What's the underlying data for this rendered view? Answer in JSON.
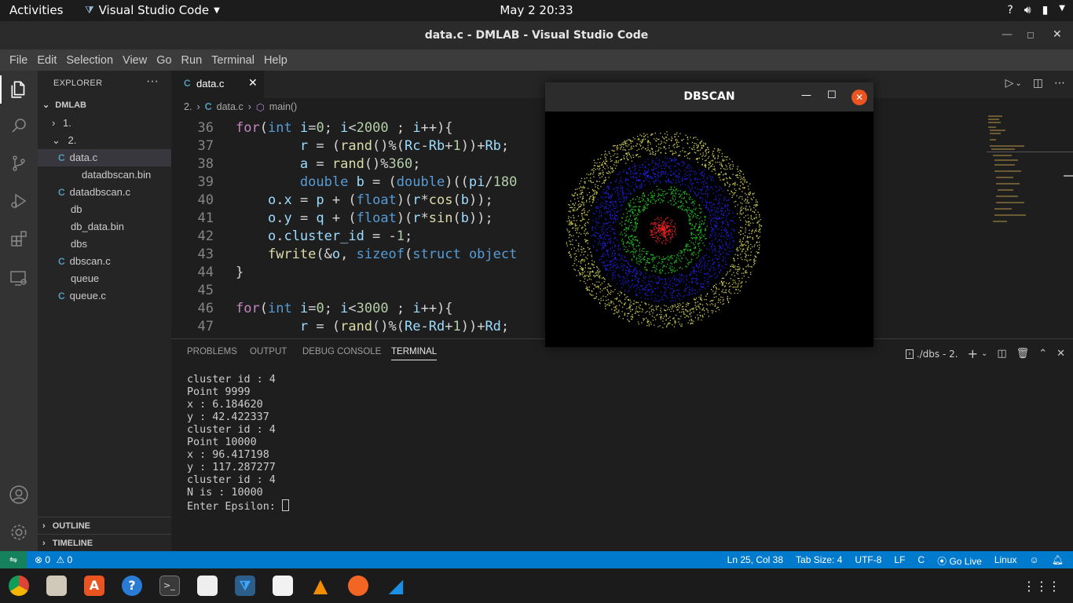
{
  "topbar": {
    "activities": "Activities",
    "app_name": "Visual Studio Code",
    "clock": "May 2  20:33"
  },
  "window": {
    "title": "data.c - DMLAB - Visual Studio Code"
  },
  "menu": [
    "File",
    "Edit",
    "Selection",
    "View",
    "Go",
    "Run",
    "Terminal",
    "Help"
  ],
  "sidebar": {
    "header": "EXPLORER",
    "root": "DMLAB",
    "folders": [
      "1.",
      "2."
    ],
    "files": [
      {
        "name": "data.c",
        "c": true
      },
      {
        "name": "datadbscan.bin",
        "c": false
      },
      {
        "name": "datadbscan.c",
        "c": true
      },
      {
        "name": "db",
        "c": false
      },
      {
        "name": "db_data.bin",
        "c": false
      },
      {
        "name": "dbs",
        "c": false
      },
      {
        "name": "dbscan.c",
        "c": true
      },
      {
        "name": "queue",
        "c": false
      },
      {
        "name": "queue.c",
        "c": true
      }
    ],
    "outline": "OUTLINE",
    "timeline": "TIMELINE"
  },
  "editor": {
    "tab": "data.c",
    "breadcrumb": [
      "2.",
      "data.c",
      "main()"
    ],
    "lines": [
      36,
      37,
      38,
      39,
      40,
      41,
      42,
      43,
      44,
      45,
      46,
      47
    ]
  },
  "panel": {
    "tabs": [
      "PROBLEMS",
      "OUTPUT",
      "DEBUG CONSOLE",
      "TERMINAL"
    ],
    "terminal_name": "./dbs - 2.",
    "terminal_lines": [
      "cluster id : 4",
      "",
      "Point 9999",
      "x : 6.184620",
      "y : 42.422337",
      "cluster id : 4",
      "",
      "Point 10000",
      "x : 96.417198",
      "y : 117.287277",
      "cluster id : 4",
      "",
      "N is : 10000",
      "Enter Epsilon: "
    ]
  },
  "status": {
    "problems": "0",
    "warnings": "0",
    "position": "Ln 25, Col 38",
    "tab_size": "Tab Size: 4",
    "encoding": "UTF-8",
    "eol": "LF",
    "language": "C",
    "go_live": "Go Live",
    "os": "Linux"
  },
  "dbscan": {
    "title": "DBSCAN",
    "rings": [
      {
        "color": "#c8c850"
      },
      {
        "color": "#2020d8"
      },
      {
        "color": "#20c020"
      },
      {
        "color": "#e02020"
      }
    ]
  },
  "colors": {
    "accent": "#007acc",
    "remote": "#16825d",
    "ubuntu_orange": "#e95420"
  }
}
